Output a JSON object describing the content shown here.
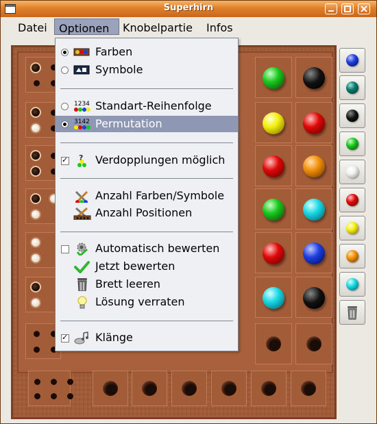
{
  "window": {
    "title": "Superhirn"
  },
  "menubar": [
    "Datei",
    "Optionen",
    "Knobelpartie",
    "Infos"
  ],
  "menu": {
    "farben": "Farben",
    "symbole": "Symbole",
    "standart": "Standart-Reihenfolge",
    "permutation": "Permutation",
    "verdopplungen": "Verdopplungen möglich",
    "anzahl_farben": "Anzahl Farben/Symbole",
    "anzahl_positionen": "Anzahl Positionen",
    "auto_bewerten": "Automatisch bewerten",
    "jetzt_bewerten": "Jetzt bewerten",
    "brett_leeren": "Brett leeren",
    "loesung": "Lösung verraten",
    "klaenge": "Klänge",
    "standart_icon_text": "1234",
    "permutation_icon_text": "3142"
  },
  "state": {
    "farben_selected": true,
    "permutation_selected": true,
    "verdopplungen_checked": true,
    "auto_bewerten_checked": false,
    "klaenge_checked": true
  },
  "colors": {
    "blue": "#1f3fe0",
    "teal": "#0b7a6e",
    "black": "#111111",
    "green": "#19c81c",
    "white": "#ffffff",
    "red": "#e00808",
    "yellow": "#f2ee0c",
    "orange": "#f29008",
    "cyan": "#1ad8e4"
  },
  "palette": [
    "blue",
    "teal",
    "black",
    "green",
    "white",
    "red",
    "yellow",
    "orange",
    "cyan",
    "trash-icon"
  ],
  "guess_rows_visible_right": [
    [
      "green",
      "black"
    ],
    [
      "yellow",
      "red"
    ],
    [
      "red",
      "orange"
    ],
    [
      "green",
      "cyan"
    ],
    [
      "red",
      "blue"
    ],
    [
      "cyan",
      "black"
    ]
  ]
}
